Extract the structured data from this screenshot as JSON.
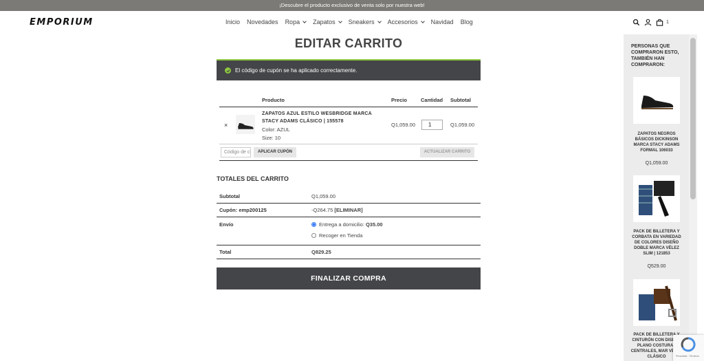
{
  "announcement": "¡Descubre el producto exclusivo de venta solo por nuestra web!",
  "header": {
    "logo": "EMPORIUM",
    "nav": [
      {
        "label": "Inicio",
        "dropdown": false
      },
      {
        "label": "Novedades",
        "dropdown": false
      },
      {
        "label": "Ropa",
        "dropdown": true
      },
      {
        "label": "Zapatos",
        "dropdown": true
      },
      {
        "label": "Sneakers",
        "dropdown": true
      },
      {
        "label": "Accesorios",
        "dropdown": true
      },
      {
        "label": "Navidad",
        "dropdown": false
      },
      {
        "label": "Blog",
        "dropdown": false
      }
    ],
    "cart_count": "1"
  },
  "page_title": "EDITAR CARRITO",
  "notice": "El código de cupón se ha aplicado correctamente.",
  "cart": {
    "headers": {
      "product": "Producto",
      "price": "Precio",
      "quantity": "Cantidad",
      "subtotal": "Subtotal"
    },
    "item": {
      "remove": "×",
      "name": "ZAPATOS AZUL ESTILO WESBRIDGE MARCA STACY ADAMS CLÁSICO | 155578",
      "color": "Color: AZUL",
      "size": "Size: 10",
      "price": "Q1,059.00",
      "quantity": "1",
      "subtotal": "Q1,059.00"
    },
    "coupon_placeholder": "Código de cupón",
    "apply_coupon": "APLICAR CUPÓN",
    "update_cart": "ACTUALIZAR CARRITO"
  },
  "totals": {
    "title": "TOTALES DEL CARRITO",
    "subtotal_label": "Subtotal",
    "subtotal_value": "Q1,059.00",
    "coupon_label": "Cupón: emp200125",
    "coupon_value": "-Q264.75",
    "coupon_remove": "[ELIMINAR]",
    "shipping_label": "Envío",
    "shipping_home": "Entrega a domicilio:",
    "shipping_home_price": "Q35.00",
    "shipping_pickup": "Recoger en Tienda",
    "total_label": "Total",
    "total_value": "Q829.25"
  },
  "checkout": "FINALIZAR COMPRA",
  "sidebar": {
    "title": "PERSONAS QUE COMPRARON ESTO, TAMBIÉN HAN COMPRARON:",
    "products": [
      {
        "name": "ZAPATOS NEGROS BÁSICOS DICKINSON MARCA STACY ADAMS FORMAL 106033",
        "price": "Q1,059.00"
      },
      {
        "name": "PACK DE BILLETERA Y CORBATA EN VARIEDAD DE COLORES DISEÑO DOBLE MARCA VÉLEZ SLIM | 121853",
        "price": "Q529.00"
      },
      {
        "name": "PACK DE BILLETERA Y CINTURÓN CON DISEÑO PLANO COSTURAS CENTRALES, MAR VÉLEZ CLÁSICO",
        "price": ""
      }
    ]
  },
  "recaptcha": "Privacidad - Términos"
}
